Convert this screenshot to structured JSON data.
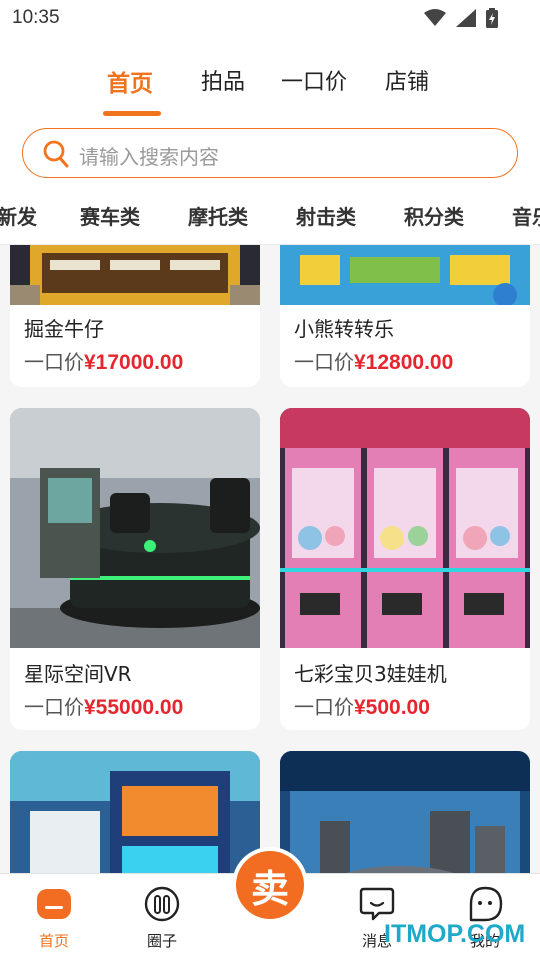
{
  "status": {
    "time": "10:35"
  },
  "top_tabs": [
    {
      "label": "首页",
      "active": true
    },
    {
      "label": "拍品",
      "active": false
    },
    {
      "label": "一口价",
      "active": false
    },
    {
      "label": "店铺",
      "active": false
    }
  ],
  "search": {
    "placeholder": "请输入搜索内容"
  },
  "categories": [
    "新发",
    "赛车类",
    "摩托类",
    "射击类",
    "积分类",
    "音乐"
  ],
  "price_prefix": "一口价",
  "products": [
    {
      "title": "掘金牛仔",
      "price": "¥17000.00",
      "image": "gold-mining-arcade-machine"
    },
    {
      "title": "小熊转转乐",
      "price": "¥12800.00",
      "image": "bear-spinning-coin-pusher"
    },
    {
      "title": "星际空间VR",
      "price": "¥55000.00",
      "image": "vr-spaceship-simulator"
    },
    {
      "title": "七彩宝贝3娃娃机",
      "price": "¥500.00",
      "image": "claw-crane-machines"
    },
    {
      "title": "",
      "price": "",
      "image": "racing-arcade-cabinet"
    },
    {
      "title": "",
      "price": "",
      "image": "robot-ride-display"
    }
  ],
  "bottom_nav": {
    "home": "首页",
    "circle": "圈子",
    "sell": "卖",
    "messages": "消息",
    "mine": "我的"
  },
  "watermark": "ITMOP.COM",
  "colors": {
    "accent": "#f0731e",
    "price": "#e6262f",
    "background": "#f5f5f5"
  }
}
